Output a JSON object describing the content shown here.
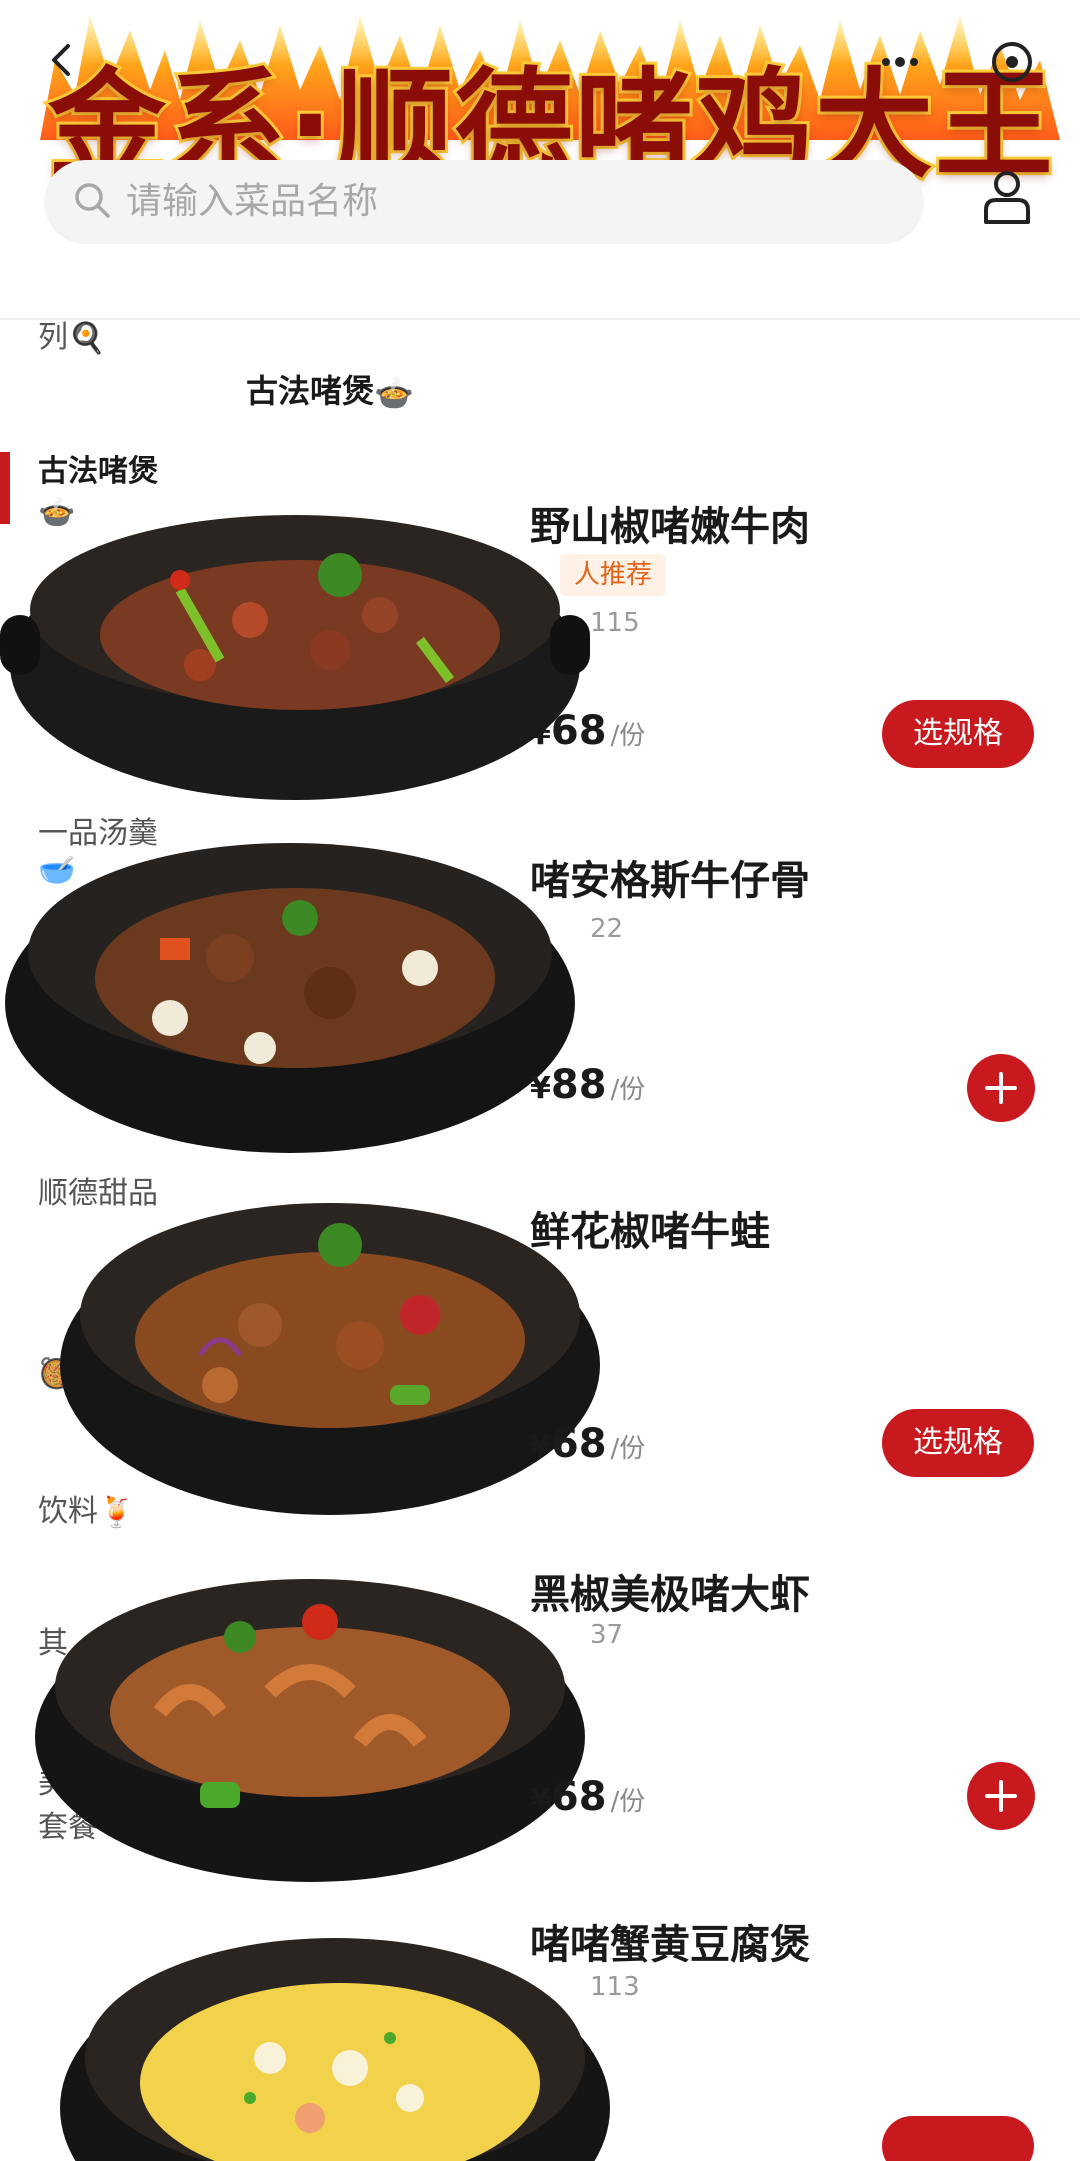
{
  "header": {
    "store_title": "金系·顺德啫鸡大王",
    "search_placeholder": "请输入菜品名称",
    "icons": [
      "back-icon",
      "more-icon",
      "close-icon",
      "search-icon",
      "user-icon"
    ]
  },
  "sidebar": {
    "items": [
      {
        "label": "列",
        "emoji": "🍳"
      },
      {
        "label": "古法啫煲",
        "emoji": "🍲",
        "active": true
      },
      {
        "label": "一品汤羹",
        "emoji": "🥣"
      },
      {
        "label": "顺德甜品",
        "emoji": "🥘"
      },
      {
        "label": "饮料",
        "emoji": "🍹"
      },
      {
        "label": "其"
      },
      {
        "label": "美"
      },
      {
        "label": "套餐"
      }
    ]
  },
  "section": {
    "title": "古法啫煲",
    "emoji": "🍲"
  },
  "products": [
    {
      "name": "野山椒啫嫩牛肉",
      "badge": "人推荐",
      "sales": "115",
      "currency": "¥",
      "price": "68",
      "unit": "/份",
      "action": "选规格"
    },
    {
      "name": "啫安格斯牛仔骨",
      "sales": "22",
      "currency": "¥",
      "price": "88",
      "unit": "/份",
      "action": "+"
    },
    {
      "name": "鲜花椒啫牛蛙",
      "currency": "¥",
      "price": "68",
      "unit": "/份",
      "action": "选规格"
    },
    {
      "name": "黑椒美极啫大虾",
      "sales": "37",
      "currency": "¥",
      "price": "68",
      "unit": "/份",
      "action": "+"
    },
    {
      "name": "啫啫蟹黄豆腐煲",
      "sales": "113"
    }
  ],
  "colors": {
    "accent": "#c8191f",
    "badge_text": "#e0641a",
    "title_fill": "#8b0d08",
    "title_stroke": "#ffd23a"
  }
}
